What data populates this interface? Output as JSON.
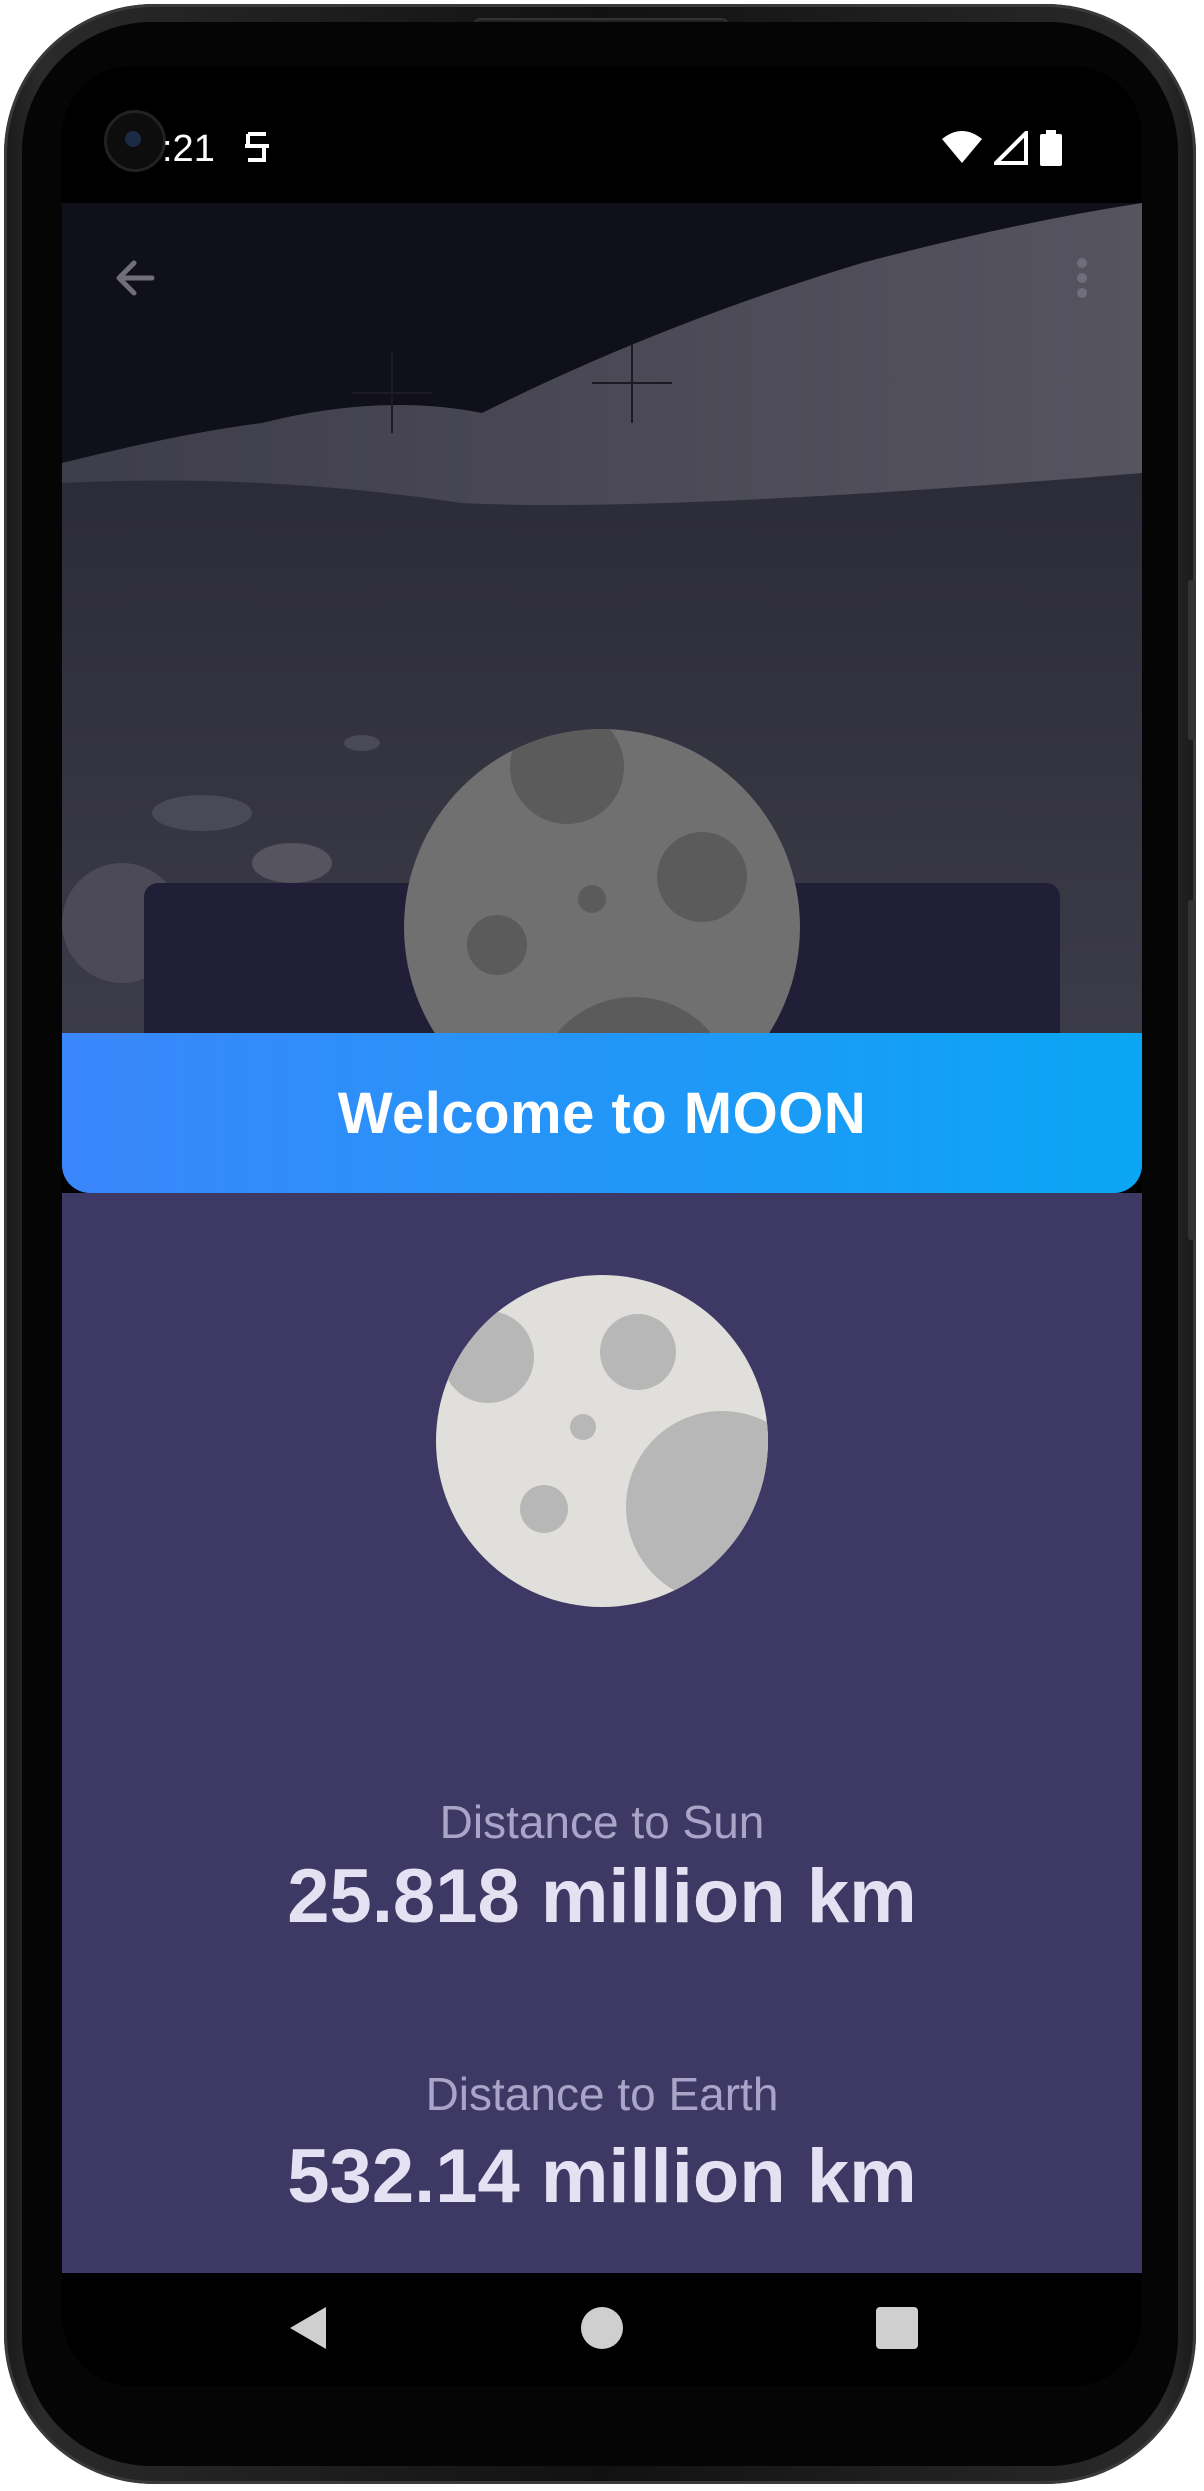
{
  "status_bar": {
    "time": ":21"
  },
  "hero": {
    "back_icon": "arrow-left-icon",
    "more_icon": "more-vertical-icon"
  },
  "banner": {
    "title": "Welcome to MOON"
  },
  "stats": [
    {
      "label": "Distance to Sun",
      "value": "25.818 million km"
    },
    {
      "label": "Distance to Earth",
      "value": "532.14 million km"
    }
  ],
  "colors": {
    "banner_start": "#3b86fb",
    "banner_end": "#0aa6f4",
    "content_bg": "#3e3964",
    "card_bg": "#211e37"
  }
}
